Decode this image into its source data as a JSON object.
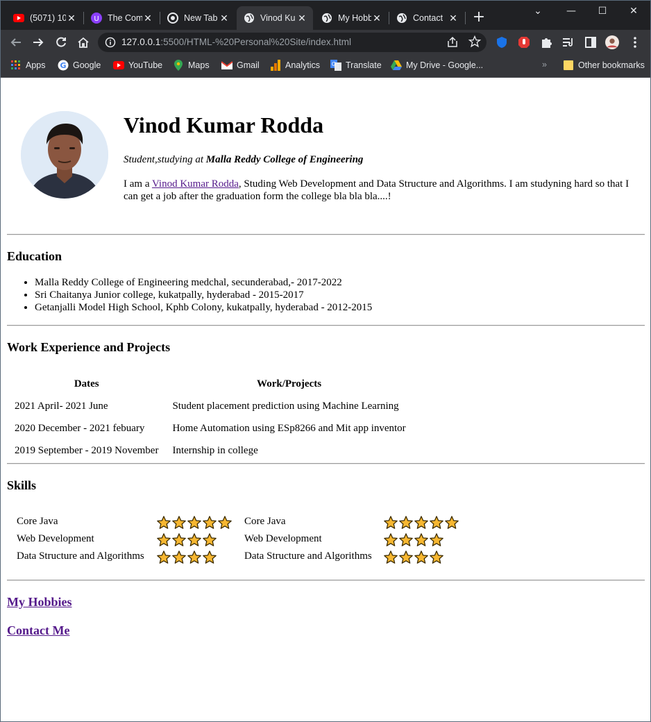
{
  "browser": {
    "tabs": [
      {
        "title": "(5071) 10",
        "icon": "youtube-icon"
      },
      {
        "title": "The Com",
        "icon": "extension-icon"
      },
      {
        "title": "New Tab",
        "icon": "chrome-icon"
      },
      {
        "title": "Vinod Ku",
        "icon": "globe-icon",
        "active": true
      },
      {
        "title": "My Hobb",
        "icon": "globe-icon"
      },
      {
        "title": "Contact",
        "icon": "globe-icon"
      }
    ],
    "url_host": "127.0.0.1",
    "url_rest": ":5500/HTML-%20Personal%20Site/index.html",
    "bookmarks": [
      {
        "label": "Apps",
        "icon": "apps-grid-icon"
      },
      {
        "label": "Google",
        "icon": "google-icon"
      },
      {
        "label": "YouTube",
        "icon": "youtube-icon"
      },
      {
        "label": "Maps",
        "icon": "maps-icon"
      },
      {
        "label": "Gmail",
        "icon": "gmail-icon"
      },
      {
        "label": "Analytics",
        "icon": "analytics-icon"
      },
      {
        "label": "Translate",
        "icon": "translate-icon"
      },
      {
        "label": "My Drive - Google...",
        "icon": "drive-icon"
      }
    ],
    "overflow": "»",
    "other_bookmarks": "Other bookmarks"
  },
  "profile": {
    "name": "Vinod Kumar Rodda",
    "subtitle_prefix": "Student,studying at ",
    "college": "Malla Reddy College of Engineering",
    "intro_prefix": "I am a ",
    "intro_link": "Vinod Kumar Rodda",
    "intro_suffix": ", Studing Web Development and Data Structure and Algorithms. I am studyning hard so that I can get a job after the graduation form the college bla bla bla....!"
  },
  "education": {
    "heading": "Education",
    "items": [
      "Malla Reddy College of Engineering medchal, secunderabad,- 2017-2022",
      "Sri Chaitanya Junior college, kukatpally, hyderabad - 2015-2017",
      "Getanjalli Model High School, Kphb Colony, kukatpally, hyderabad - 2012-2015"
    ]
  },
  "work": {
    "heading": "Work Experience and Projects",
    "columns": [
      "Dates",
      "Work/Projects"
    ],
    "rows": [
      [
        "2021 April- 2021 June",
        "Student placement prediction using Machine Learning"
      ],
      [
        "2020 December - 2021 febuary",
        "Home Automation using ESp8266 and Mit app inventor"
      ],
      [
        "2019 September - 2019 November",
        "Internship in college"
      ]
    ]
  },
  "skills": {
    "heading": "Skills",
    "left": [
      {
        "name": "Core Java",
        "stars": 5
      },
      {
        "name": "Web Development",
        "stars": 4
      },
      {
        "name": "Data Structure and Algorithms",
        "stars": 4
      }
    ],
    "right": [
      {
        "name": "Core Java",
        "stars": 5
      },
      {
        "name": "Web Development",
        "stars": 4
      },
      {
        "name": "Data Structure and Algorithms",
        "stars": 4
      }
    ]
  },
  "links": {
    "hobbies": "My Hobbies",
    "contact": "Contact Me"
  },
  "colors": {
    "visited_link": "#551a8b",
    "star_fill": "#f7b731",
    "tabstrip": "#202124",
    "toolbar": "#35363a"
  }
}
